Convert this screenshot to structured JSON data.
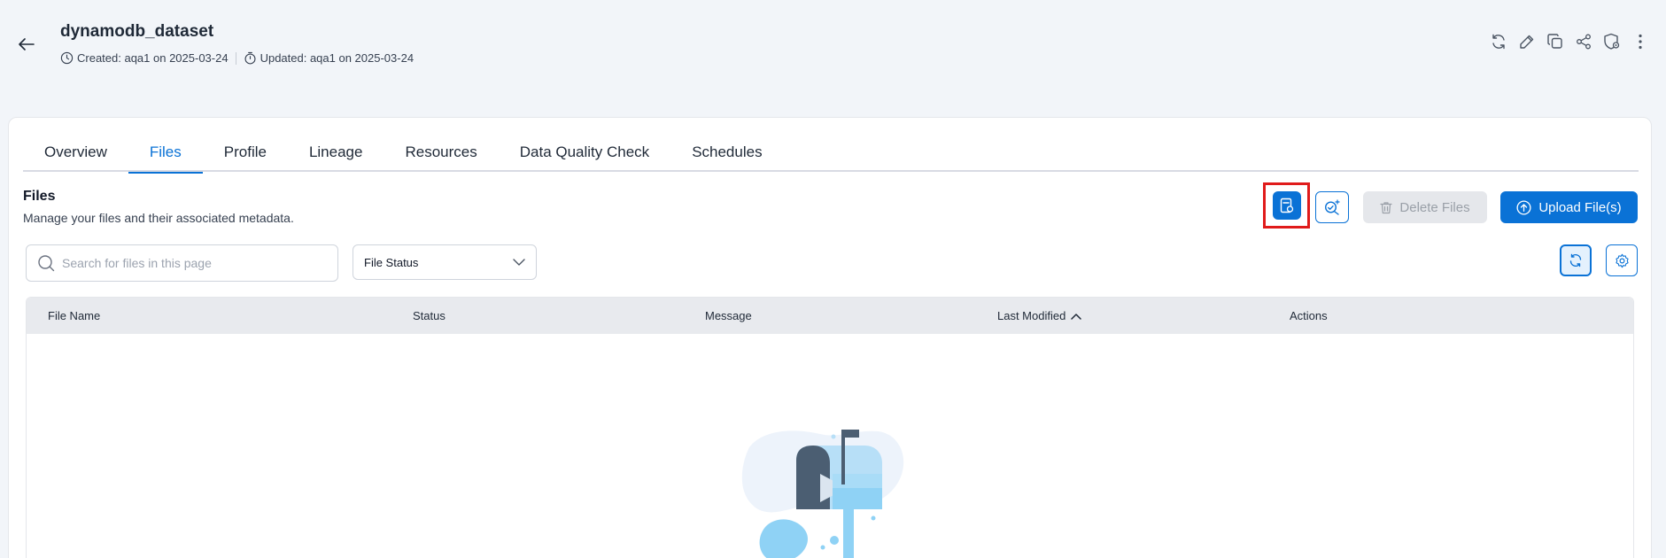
{
  "header": {
    "title": "dynamodb_dataset",
    "created": "Created: aqa1 on 2025-03-24",
    "updated": "Updated: aqa1 on 2025-03-24"
  },
  "tabs": [
    {
      "label": "Overview"
    },
    {
      "label": "Files",
      "active": true
    },
    {
      "label": "Profile"
    },
    {
      "label": "Lineage"
    },
    {
      "label": "Resources"
    },
    {
      "label": "Data Quality Check"
    },
    {
      "label": "Schedules"
    }
  ],
  "section": {
    "title": "Files",
    "subtitle": "Manage your files and their associated metadata."
  },
  "actions": {
    "delete_label": "Delete Files",
    "upload_label": "Upload File(s)"
  },
  "filters": {
    "search_placeholder": "Search for files in this page",
    "status_label": "File Status"
  },
  "table": {
    "columns": [
      "File Name",
      "Status",
      "Message",
      "Last Modified",
      "Actions"
    ],
    "sort_column": "Last Modified",
    "sort_direction": "ascending",
    "rows": []
  },
  "colors": {
    "primary": "#0a72d6",
    "highlight": "#e01b1b",
    "background": "#f2f5f9"
  }
}
